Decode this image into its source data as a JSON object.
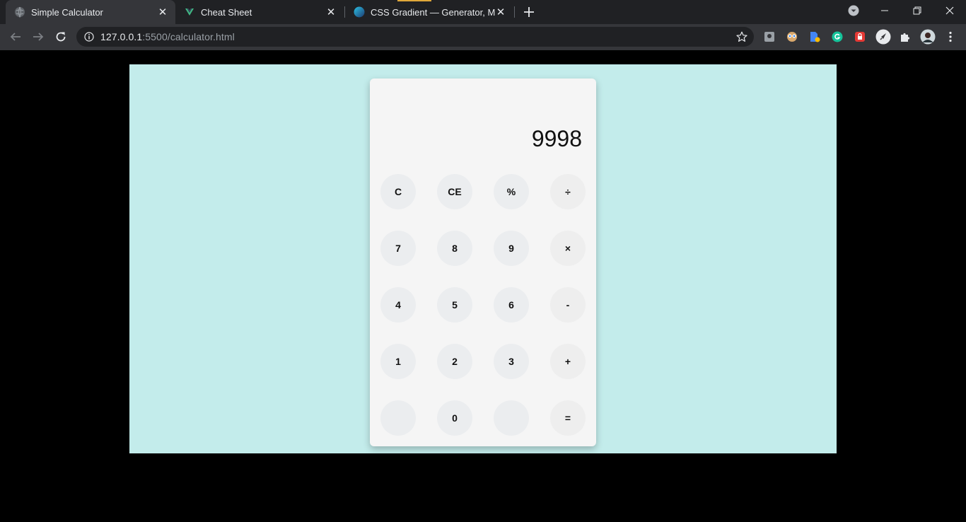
{
  "browser": {
    "tabs": [
      {
        "title": "Simple Calculator",
        "active": true,
        "favicon": "globe-icon"
      },
      {
        "title": "Cheat Sheet",
        "active": false,
        "favicon": "vue-icon"
      },
      {
        "title": "CSS Gradient — Generator, Maker",
        "active": false,
        "favicon": "css-gradient-icon"
      }
    ],
    "url_host": "127.0.0.1",
    "url_path": ":5500/calculator.html",
    "extensions": [
      "screenshot-icon",
      "eyes-icon",
      "docs-icon",
      "grammarly-icon",
      "lock-icon",
      "rocket-icon",
      "puzzle-icon",
      "avatar"
    ]
  },
  "page": {
    "background": "#c3eceb"
  },
  "calculator": {
    "display": "9998",
    "keys": {
      "clear": "C",
      "clear_entry": "CE",
      "percent": "%",
      "divide": "÷",
      "seven": "7",
      "eight": "8",
      "nine": "9",
      "multiply": "×",
      "four": "4",
      "five": "5",
      "six": "6",
      "subtract": "-",
      "one": "1",
      "two": "2",
      "three": "3",
      "add": "+",
      "blank_left": "",
      "zero": "0",
      "blank_right": "",
      "equals": "="
    }
  }
}
